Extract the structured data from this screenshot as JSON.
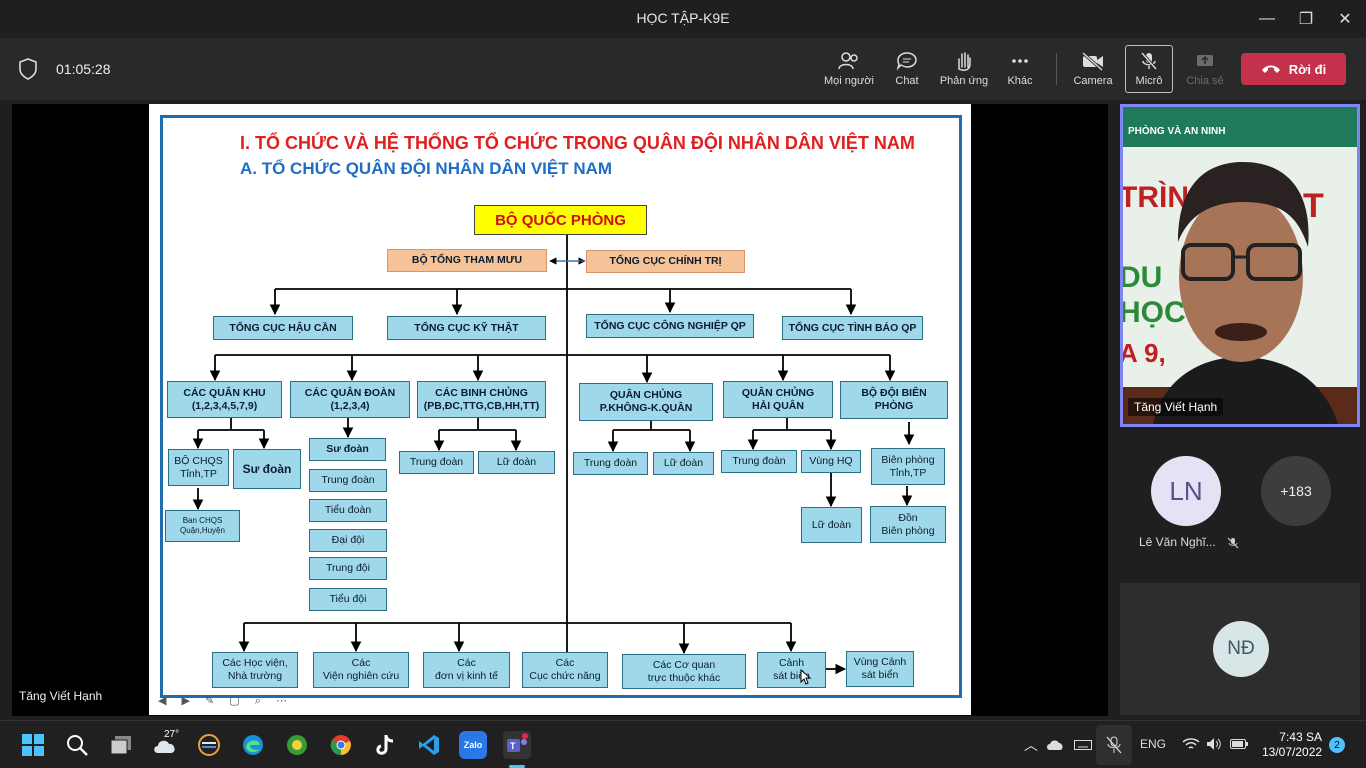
{
  "window": {
    "title": "HỌC TẬP-K9E",
    "minimize": "—",
    "restore": "❐",
    "close": "✕"
  },
  "toolbar": {
    "timer": "01:05:28",
    "people": "Mọi người",
    "chat": "Chat",
    "reactions": "Phản ứng",
    "more": "Khác",
    "camera": "Camera",
    "mic": "Micrô",
    "share": "Chia sẻ",
    "leave": "Rời đi",
    "leave_color": "#c4314b"
  },
  "slide": {
    "heading1": "I. TỔ CHỨC VÀ HỆ THỐNG TỔ CHỨC TRONG QUÂN ĐỘI NHÂN DÂN VIỆT NAM",
    "heading2": "A. TỔ CHỨC QUÂN ĐỘI NHÂN DÂN VIỆT NAM",
    "root": "BỘ QUỐC PHÒNG",
    "level1": [
      "BỘ TỔNG THAM MƯU",
      "TỔNG CỤC CHÍNH TRỊ"
    ],
    "level2": [
      "TỔNG CỤC HẬU CẦN",
      "TỔNG CỤC KỸ THẬT",
      "TỔNG CỤC CÔNG NGHIỆP QP",
      "TỔNG CỤC TÌNH BÁO QP"
    ],
    "level3": [
      "CÁC QUÂN KHU\n(1,2,3,4,5,7,9)",
      "CÁC QUÂN ĐOÀN\n(1,2,3,4)",
      "CÁC BINH CHỦNG\n(PB,ĐC,TTG,CB,HH,TT)",
      "QUÂN CHỦNG\nP.KHÔNG-K.QUÂN",
      "QUÂN CHỦNG\nHẢI QUÂN",
      "BỘ ĐỘI BIÊN\nPHÒNG"
    ],
    "quankhu": {
      "bchqs": "BỘ CHQS\nTỉnh,TP",
      "suđoan": "Sư đoàn",
      "ban": "Ban CHQS\nQuận,Huyện"
    },
    "quandoan": [
      "Sư đoàn",
      "Trung đoàn",
      "Tiểu đoàn",
      "Đại đội",
      "Trung đội",
      "Tiểu đội"
    ],
    "binhchung": [
      "Trung đoàn",
      "Lữ đoàn"
    ],
    "phongkhong": [
      "Trung đoàn",
      "Lữ đoàn"
    ],
    "haiquan": [
      "Trung đoàn",
      "Vùng HQ",
      "Lữ đoàn"
    ],
    "bienphong": [
      "Biên phòng\nTỉnh,TP",
      "Đồn\nBiên phòng"
    ],
    "bottom": [
      "Các Học viện,\nNhà trường",
      "Các\nViện nghiên cứu",
      "Các\nđơn vị kinh tế",
      "Các\nCục chức năng",
      "Các Cơ quan\ntrực thuộc khác",
      "Cảnh\nsát biển",
      "Vùng Cảnh\nsát biển"
    ],
    "presenter_caption": "Tăng Viết Hạnh"
  },
  "participants": {
    "video_name": "Tăng Viết Hạnh",
    "video_banner": "PHÒNG VÀ AN NINH",
    "ln_initials": "LN",
    "ln_name": "Lê Văn Nghĩ...",
    "others": "+183",
    "nd_initials": "NĐ"
  },
  "taskbar": {
    "weather": "27°",
    "zalo": "Zalo",
    "lang": "ENG",
    "time": "7:43 SA",
    "date": "13/07/2022",
    "notifications": "2"
  }
}
